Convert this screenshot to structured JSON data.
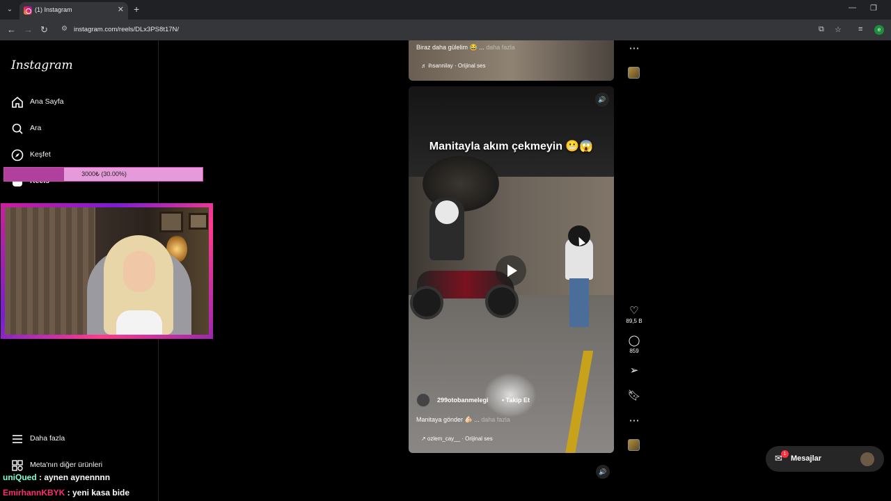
{
  "browser": {
    "tab_title": "(1) Instagram",
    "tab_close": "✕",
    "new_tab": "+",
    "url": "instagram.com/reels/DLx3PS8t17N/",
    "profile_initial": "e",
    "minimize": "—",
    "restore": "❐"
  },
  "sidebar": {
    "logo": "Instagram",
    "items": [
      {
        "label": "Ana Sayfa",
        "icon": "home-icon"
      },
      {
        "label": "Ara",
        "icon": "search-icon"
      },
      {
        "label": "Keşfet",
        "icon": "compass-icon"
      },
      {
        "label": "Reels",
        "icon": "reels-icon"
      },
      {
        "label": "Daha fazla",
        "icon": "menu-icon"
      },
      {
        "label": "Meta'nın diğer ürünleri",
        "icon": "meta-icon"
      }
    ]
  },
  "overlay": {
    "donation_goal": "3000₺ (30.00%)",
    "donation_progress": 0.3,
    "chat": [
      {
        "user": "uniQued",
        "message": " : aynen aynennnn",
        "color": "#7fffd4"
      },
      {
        "user": "EmirhannKBYK",
        "message": " : yeni kasa bide",
        "color": "#ff2d6f"
      }
    ]
  },
  "reels": {
    "previous": {
      "caption": "Biraz daha gülelim 😂 ...",
      "more": " daha fazla",
      "audio": "♬ ihsannilay · Orijinal ses"
    },
    "current": {
      "title_overlay": "Manitayla akım çekmeyin 😬😱",
      "username": "299otobanmelegi",
      "follow": "• Takip Et",
      "caption": "Manitaya gönder 🫵🏻 ...",
      "more": " daha fazla",
      "audio": "↗ ozlem_cay__ · Orijinal ses",
      "likes": "89,5 B",
      "comments": "859"
    }
  },
  "messages": {
    "label": "Mesajlar",
    "badge": "1"
  },
  "colors": {
    "accent": "#ff3040",
    "donation_fill": "#b13f9d",
    "donation_bg": "#e69ad9"
  }
}
